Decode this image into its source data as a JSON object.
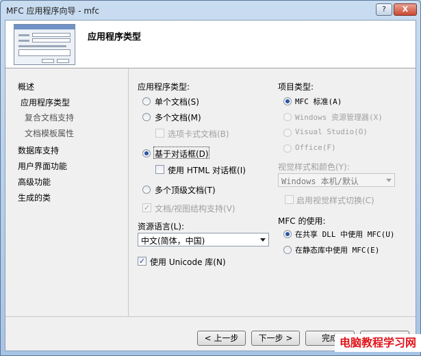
{
  "window": {
    "title": "MFC 应用程序向导 - mfc",
    "help_btn": "?",
    "close_btn": "X"
  },
  "header": {
    "title": "应用程序类型"
  },
  "nav": {
    "items": [
      "概述",
      "应用程序类型",
      "复合文档支持",
      "文档模板属性",
      "数据库支持",
      "用户界面功能",
      "高级功能",
      "生成的类"
    ]
  },
  "app_type": {
    "label": "应用程序类型:",
    "options": [
      {
        "label": "单个文档(S)",
        "selected": false
      },
      {
        "label": "多个文档(M)",
        "selected": false
      },
      {
        "label": "基于对话框(D)",
        "selected": true
      },
      {
        "label": "多个顶级文档(T)",
        "selected": false
      }
    ],
    "tabbed_docs": "选项卡式文档(B)",
    "html_dialog": "使用 HTML 对话框(I)",
    "doc_view": "文档/视图结构支持(V)"
  },
  "resource_lang": {
    "label": "资源语言(L):",
    "value": "中文(简体，中国)"
  },
  "unicode": {
    "label": "使用 Unicode 库(N)",
    "checked": true
  },
  "project_type": {
    "label": "项目类型:",
    "options": [
      {
        "label": "MFC 标准(A)",
        "selected": true,
        "enabled": true
      },
      {
        "label": "Windows 资源管理器(X)",
        "selected": false,
        "enabled": false
      },
      {
        "label": "Visual Studio(O)",
        "selected": false,
        "enabled": false
      },
      {
        "label": "Office(F)",
        "selected": false,
        "enabled": false
      }
    ]
  },
  "visual_style": {
    "label": "视觉样式和颜色(Y):",
    "value": "Windows 本机/默认",
    "toggle_label": "启用视觉样式切换(C)"
  },
  "mfc_use": {
    "label": "MFC 的使用:",
    "options": [
      {
        "label": "在共享 DLL 中使用 MFC(U)",
        "selected": true
      },
      {
        "label": "在静态库中使用 MFC(E)",
        "selected": false
      }
    ]
  },
  "footer": {
    "prev": "< 上一步",
    "next": "下一步 >",
    "finish": "完成",
    "cancel": "取消"
  },
  "watermark": "电脑教程学习网",
  "colors": {
    "accent": "#2a54a8",
    "watermark": "#e0141b"
  }
}
